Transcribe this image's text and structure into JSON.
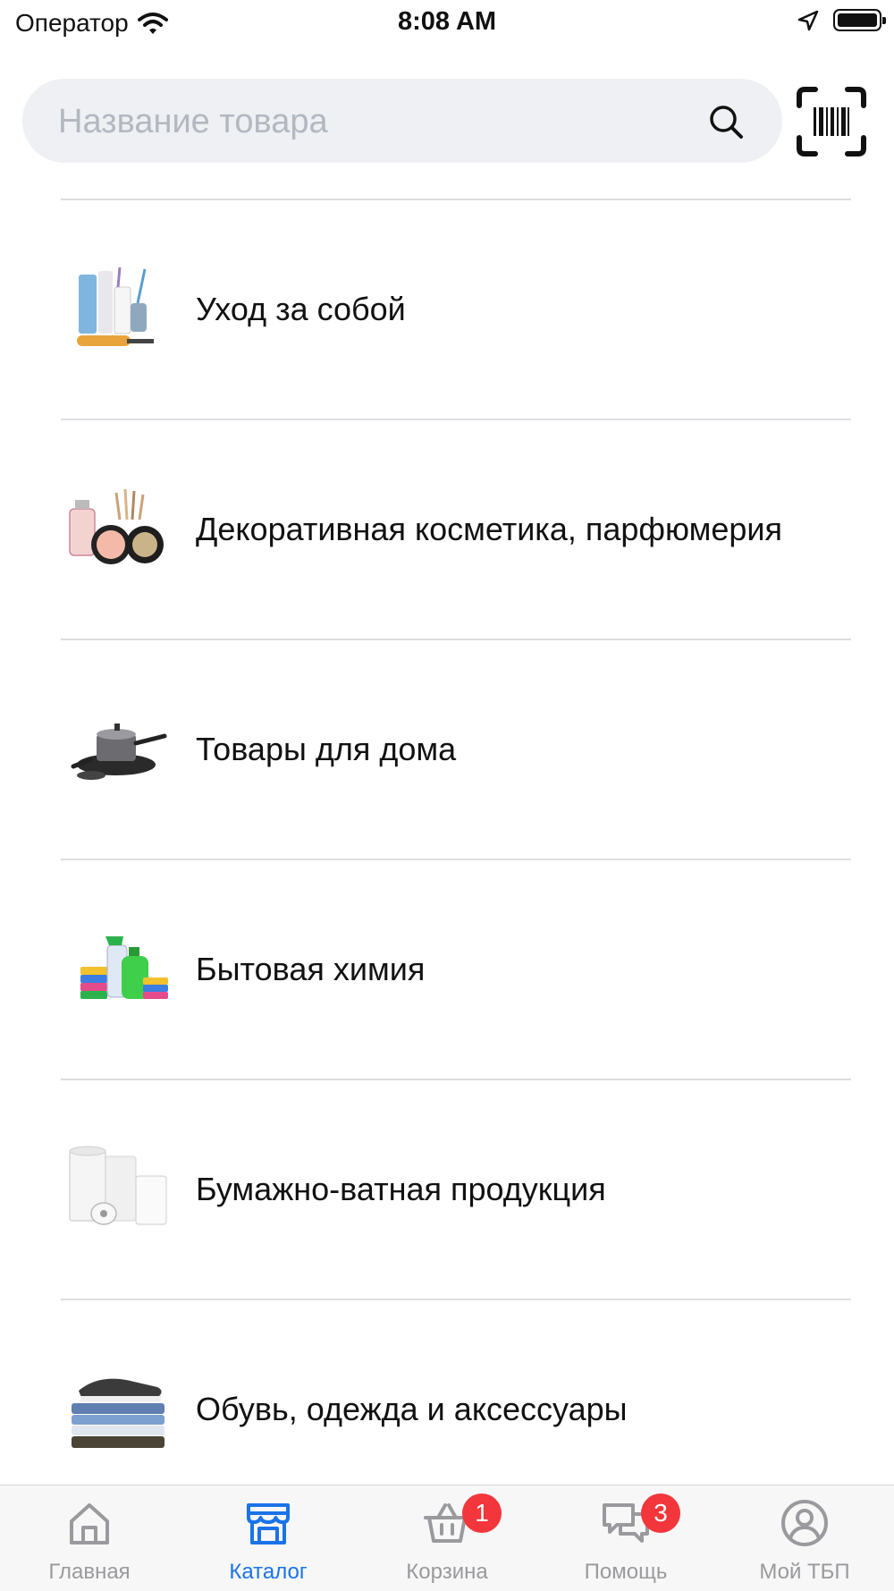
{
  "status_bar": {
    "carrier": "Оператор",
    "time": "8:08 AM"
  },
  "search": {
    "placeholder": "Название товара"
  },
  "categories": [
    {
      "label": "Уход за собой",
      "icon": "personal-care-image"
    },
    {
      "label": "Декоративная косметика, парфюмерия",
      "icon": "cosmetics-image"
    },
    {
      "label": "Товары для дома",
      "icon": "cookware-image"
    },
    {
      "label": "Бытовая химия",
      "icon": "cleaning-products-image"
    },
    {
      "label": "Бумажно-ватная продукция",
      "icon": "paper-products-image"
    },
    {
      "label": "Обувь, одежда и аксессуары",
      "icon": "clothing-image"
    }
  ],
  "tabs": [
    {
      "label": "Главная",
      "icon": "home-icon",
      "active": false
    },
    {
      "label": "Каталог",
      "icon": "store-icon",
      "active": true
    },
    {
      "label": "Корзина",
      "icon": "basket-icon",
      "badge": "1"
    },
    {
      "label": "Помощь",
      "icon": "chat-icon",
      "badge": "3"
    },
    {
      "label": "Мой ТБП",
      "icon": "profile-icon"
    }
  ],
  "colors": {
    "accent": "#1a73e8",
    "badge": "#f2363b",
    "inactive": "#9a9a9e",
    "search_bg": "#eef0f4"
  }
}
